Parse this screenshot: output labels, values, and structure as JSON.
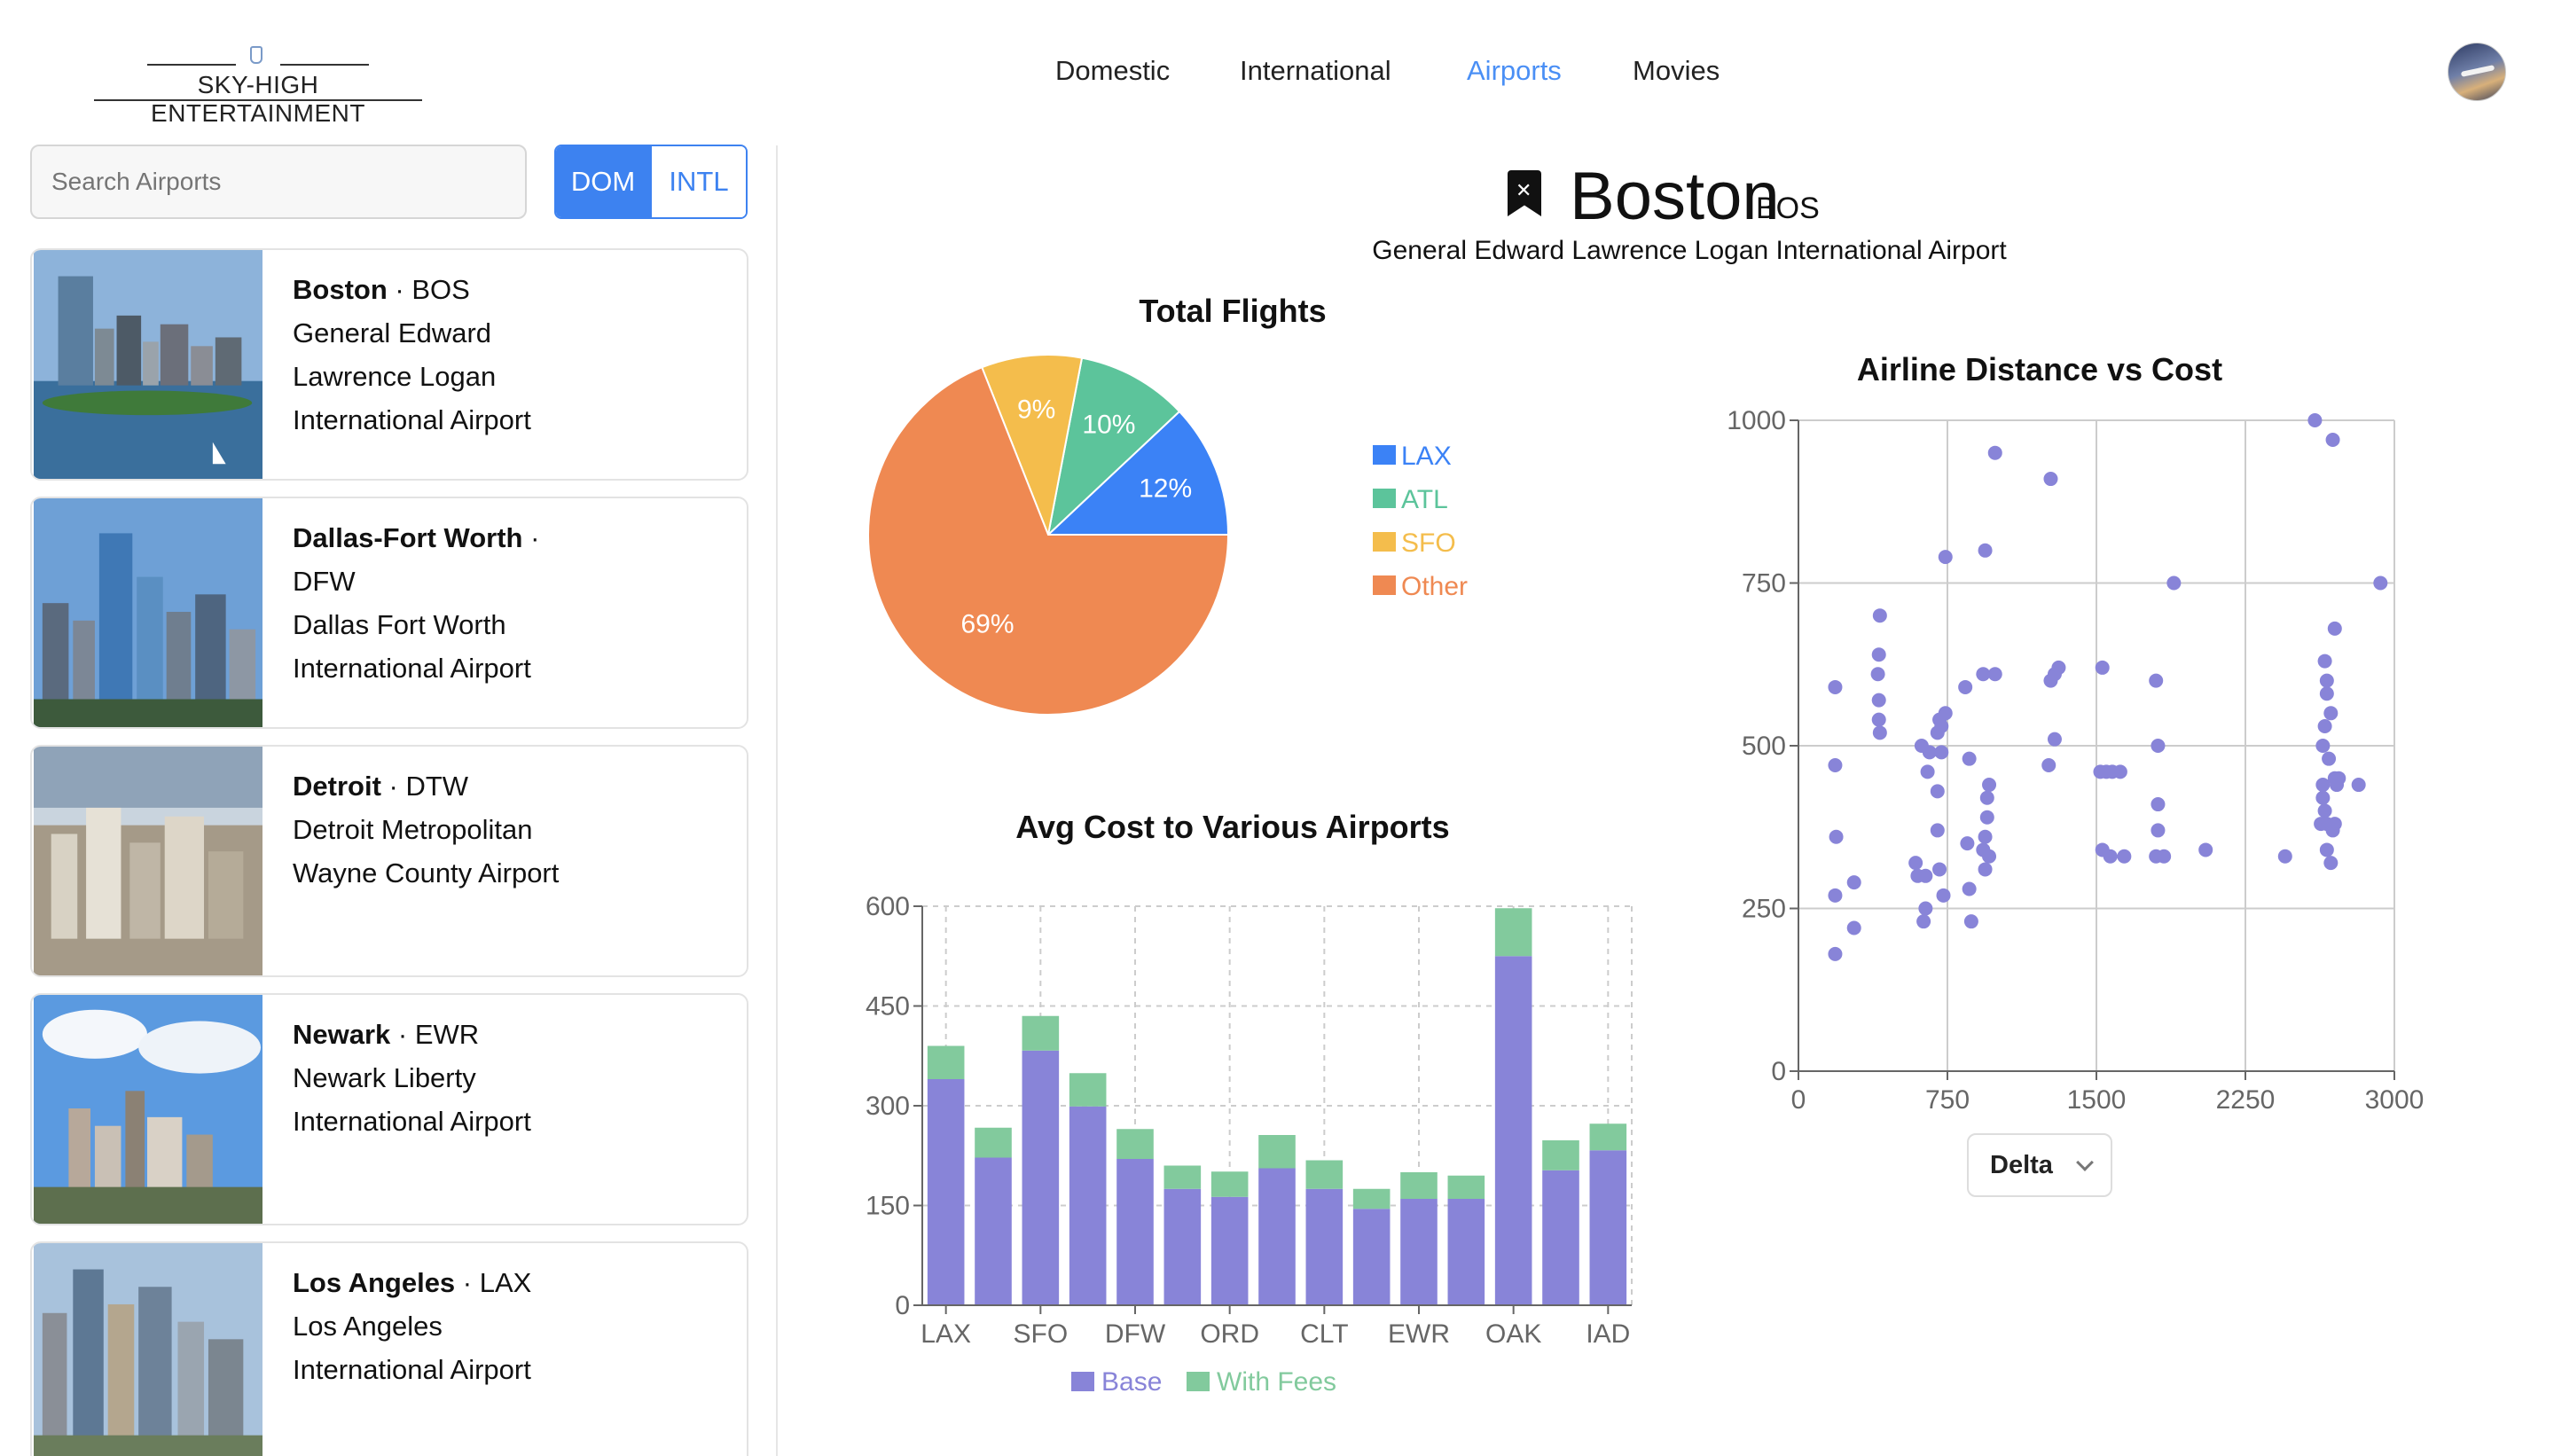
{
  "brand": {
    "name": "SKY-HIGH ENTERTAINMENT"
  },
  "nav": {
    "items": [
      "Domestic",
      "International",
      "Airports",
      "Movies"
    ],
    "active": "Airports",
    "active_color": "#4a8ff5"
  },
  "sidebar": {
    "search_placeholder": "Search Airports",
    "toggle": {
      "dom": "DOM",
      "intl": "INTL",
      "selected": "DOM"
    },
    "airports": [
      {
        "city": "Boston",
        "code": "BOS",
        "lines": [
          "General Edward",
          "Lawrence Logan",
          "International Airport"
        ]
      },
      {
        "city": "Dallas-Fort Worth",
        "code": "DFW",
        "lines": [
          "Dallas Fort Worth",
          "International Airport"
        ]
      },
      {
        "city": "Detroit",
        "code": "DTW",
        "lines": [
          "Detroit Metropolitan",
          "Wayne County Airport"
        ]
      },
      {
        "city": "Newark",
        "code": "EWR",
        "lines": [
          "Newark Liberty",
          "International Airport"
        ]
      },
      {
        "city": "Los Angeles",
        "code": "LAX",
        "lines": [
          "Los Angeles",
          "International Airport"
        ]
      }
    ]
  },
  "detail": {
    "city": "Boston",
    "code": "BOS",
    "name": "General Edward Lawrence Logan International Airport",
    "bookmark_icon": "bookmark-x-icon"
  },
  "chart_data": [
    {
      "type": "pie",
      "title": "Total Flights",
      "slices": [
        {
          "label": "LAX",
          "value": 12,
          "color": "#3b82f6"
        },
        {
          "label": "ATL",
          "value": 10,
          "color": "#5cc49b"
        },
        {
          "label": "SFO",
          "value": 9,
          "color": "#f4bd4c"
        },
        {
          "label": "Other",
          "value": 69,
          "color": "#ef8952"
        }
      ],
      "legend": "right"
    },
    {
      "type": "bar",
      "title": "Avg Cost to Various Airports",
      "stacked": true,
      "categories": [
        "LAX",
        "SFO",
        "DFW",
        "ORD",
        "CLT",
        "EWR",
        "OAK",
        "IAD"
      ],
      "bar_values": {
        "Base": [
          340,
          222,
          383,
          299,
          220,
          175,
          163,
          206,
          175,
          145,
          160,
          160,
          525,
          203,
          233
        ],
        "With Fees": [
          50,
          45,
          52,
          50,
          45,
          35,
          38,
          50,
          43,
          30,
          40,
          35,
          72,
          45,
          40
        ]
      },
      "series": [
        {
          "name": "Base",
          "color": "#8884d8"
        },
        {
          "name": "With Fees",
          "color": "#82ca9d"
        }
      ],
      "ylim": [
        0,
        600
      ],
      "yticks": [
        0,
        150,
        300,
        450,
        600
      ],
      "grid": true,
      "legend": "bottom"
    },
    {
      "type": "scatter",
      "title": "Airline Distance vs Cost",
      "xlim": [
        0,
        3000
      ],
      "ylim": [
        0,
        1000
      ],
      "xticks": [
        0,
        750,
        1500,
        2250,
        3000
      ],
      "yticks": [
        0,
        250,
        500,
        750,
        1000
      ],
      "grid": true,
      "color": "#8884d8",
      "filter": "Delta",
      "points": [
        [
          185,
          180
        ],
        [
          185,
          270
        ],
        [
          190,
          360
        ],
        [
          185,
          470
        ],
        [
          185,
          590
        ],
        [
          280,
          220
        ],
        [
          280,
          290
        ],
        [
          410,
          700
        ],
        [
          405,
          640
        ],
        [
          400,
          610
        ],
        [
          405,
          570
        ],
        [
          405,
          540
        ],
        [
          410,
          520
        ],
        [
          590,
          320
        ],
        [
          600,
          300
        ],
        [
          640,
          250
        ],
        [
          630,
          230
        ],
        [
          640,
          300
        ],
        [
          650,
          460
        ],
        [
          620,
          500
        ],
        [
          660,
          490
        ],
        [
          700,
          520
        ],
        [
          710,
          540
        ],
        [
          720,
          530
        ],
        [
          740,
          550
        ],
        [
          720,
          490
        ],
        [
          700,
          430
        ],
        [
          700,
          370
        ],
        [
          710,
          310
        ],
        [
          730,
          270
        ],
        [
          740,
          790
        ],
        [
          840,
          590
        ],
        [
          860,
          480
        ],
        [
          850,
          350
        ],
        [
          870,
          230
        ],
        [
          860,
          280
        ],
        [
          940,
          800
        ],
        [
          930,
          610
        ],
        [
          990,
          610
        ],
        [
          960,
          440
        ],
        [
          950,
          420
        ],
        [
          950,
          390
        ],
        [
          940,
          360
        ],
        [
          930,
          340
        ],
        [
          960,
          330
        ],
        [
          940,
          310
        ],
        [
          990,
          950
        ],
        [
          1270,
          910
        ],
        [
          1260,
          470
        ],
        [
          1290,
          510
        ],
        [
          1270,
          600
        ],
        [
          1290,
          610
        ],
        [
          1310,
          620
        ],
        [
          1530,
          620
        ],
        [
          1520,
          460
        ],
        [
          1550,
          460
        ],
        [
          1580,
          460
        ],
        [
          1620,
          460
        ],
        [
          1530,
          340
        ],
        [
          1570,
          330
        ],
        [
          1640,
          330
        ],
        [
          1800,
          600
        ],
        [
          1810,
          500
        ],
        [
          1810,
          410
        ],
        [
          1810,
          370
        ],
        [
          1800,
          330
        ],
        [
          1840,
          330
        ],
        [
          1890,
          750
        ],
        [
          2050,
          340
        ],
        [
          2450,
          330
        ],
        [
          2600,
          1000
        ],
        [
          2690,
          970
        ],
        [
          2650,
          630
        ],
        [
          2660,
          600
        ],
        [
          2660,
          580
        ],
        [
          2680,
          550
        ],
        [
          2650,
          530
        ],
        [
          2640,
          500
        ],
        [
          2670,
          480
        ],
        [
          2700,
          450
        ],
        [
          2640,
          440
        ],
        [
          2640,
          420
        ],
        [
          2650,
          400
        ],
        [
          2660,
          380
        ],
        [
          2700,
          380
        ],
        [
          2710,
          440
        ],
        [
          2720,
          450
        ],
        [
          2700,
          680
        ],
        [
          2690,
          370
        ],
        [
          2630,
          380
        ],
        [
          2660,
          340
        ],
        [
          2680,
          320
        ],
        [
          2820,
          440
        ],
        [
          2930,
          750
        ]
      ]
    }
  ]
}
